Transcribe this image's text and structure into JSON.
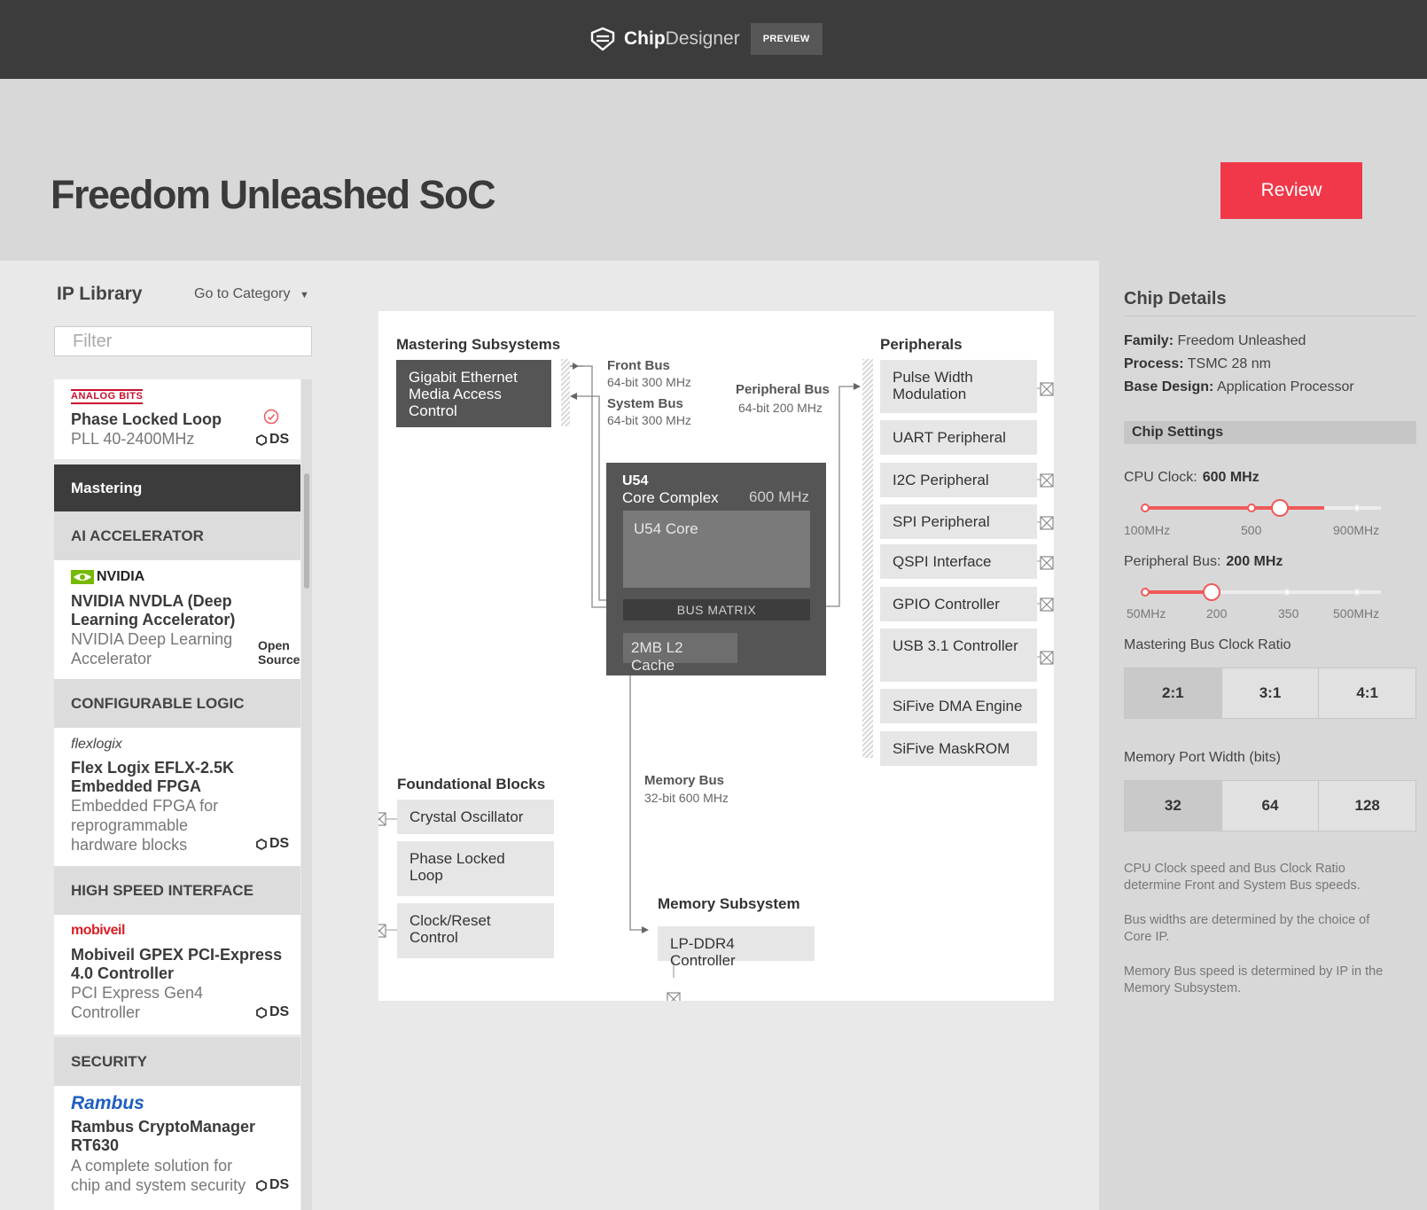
{
  "app": {
    "brand_chip": "Chip",
    "brand_designer": "Designer",
    "badge": "PREVIEW"
  },
  "page": {
    "title": "Freedom Unleashed SoC",
    "review_label": "Review"
  },
  "library": {
    "title": "IP Library",
    "category_link": "Go to Category",
    "filter_placeholder": "Filter",
    "items": [
      {
        "vendor": "ANALOG BITS",
        "name": "Phase Locked Loop",
        "desc": "PLL 40-2400MHz",
        "badge": "DS"
      },
      {
        "vendor": "NVIDIA",
        "name": "NVIDIA NVDLA (Deep Learning Accelerator)",
        "desc": "NVIDIA Deep Learning Accelerator",
        "badge": "Open Source"
      },
      {
        "vendor": "flexlogix",
        "name": "Flex Logix EFLX-2.5K Embedded FPGA",
        "desc": "Embedded FPGA for reprogrammable hardware blocks",
        "badge": "DS"
      },
      {
        "vendor": "mobiveil",
        "name": "Mobiveil GPEX PCI-Express 4.0 Controller",
        "desc": "PCI Express Gen4 Controller",
        "badge": "DS"
      },
      {
        "vendor": "Rambus",
        "name": "Rambus CryptoManager RT630",
        "desc": "A complete solution for chip and system security",
        "badge": "DS"
      }
    ],
    "sections": [
      "Mastering",
      "AI ACCELERATOR",
      "CONFIGURABLE LOGIC",
      "HIGH SPEED INTERFACE",
      "SECURITY"
    ]
  },
  "diagram": {
    "mastering_heading": "Mastering Subsystems",
    "ethernet": "Gigabit Ethernet Media Access Control",
    "front_bus": {
      "title": "Front Bus",
      "sub": "64-bit 300 MHz"
    },
    "system_bus": {
      "title": "System Bus",
      "sub": "64-bit 300 MHz"
    },
    "peripheral_bus": {
      "title": "Peripheral Bus",
      "sub": "64-bit 200 MHz"
    },
    "memory_bus": {
      "title": "Memory Bus",
      "sub": "32-bit 600 MHz"
    },
    "core_complex": {
      "title": "U54",
      "sub": "Core Complex",
      "freq": "600 MHz",
      "core": "U54 Core",
      "matrix": "BUS MATRIX",
      "l2": "2MB L2 Cache"
    },
    "peripherals_heading": "Peripherals",
    "peripherals": [
      "Pulse Width Modulation",
      "UART Peripheral",
      "I2C Peripheral",
      "SPI Peripheral",
      "QSPI Interface",
      "GPIO Controller",
      "USB 3.1 Controller",
      "SiFive DMA Engine",
      "SiFive MaskROM"
    ],
    "foundational_heading": "Foundational Blocks",
    "foundational": [
      "Crystal Oscillator",
      "Phase Locked Loop",
      "Clock/Reset Control"
    ],
    "memory_heading": "Memory Subsystem",
    "memory_block": "LP-DDR4 Controller"
  },
  "details": {
    "title": "Chip Details",
    "family_label": "Family:",
    "family": "Freedom Unleashed",
    "process_label": "Process:",
    "process": "TSMC 28 nm",
    "base_label": "Base Design:",
    "base": "Application Processor",
    "settings_title": "Chip Settings",
    "cpu_clock_label": "CPU Clock:",
    "cpu_clock_value": "600 MHz",
    "cpu_ticks": [
      "100MHz",
      "500",
      "900MHz"
    ],
    "cpu_clock_mhz": 600,
    "peripheral_label": "Peripheral Bus:",
    "peripheral_value": "200 MHz",
    "peripheral_ticks": [
      "50MHz",
      "200",
      "350",
      "500MHz"
    ],
    "peripheral_mhz": 200,
    "ratio_label": "Mastering Bus Clock Ratio",
    "ratio_options": [
      "2:1",
      "3:1",
      "4:1"
    ],
    "ratio_selected": "2:1",
    "width_label": "Memory Port Width (bits)",
    "width_options": [
      "32",
      "64",
      "128"
    ],
    "width_selected": "32",
    "notes": [
      "CPU Clock speed and Bus Clock Ratio determine Front and System Bus speeds.",
      "Bus widths are determined by the choice of Core IP.",
      "Memory Bus speed is determined by IP in the Memory Subsystem."
    ]
  },
  "colors": {
    "accent": "#f0384a",
    "slider": "#ef5a5a",
    "topbar": "#3c3c3c",
    "nvidia_green": "#76b900",
    "rambus_blue": "#1f5fbf",
    "mobiveil_red": "#d81f26",
    "analog_red": "#c8102e"
  }
}
